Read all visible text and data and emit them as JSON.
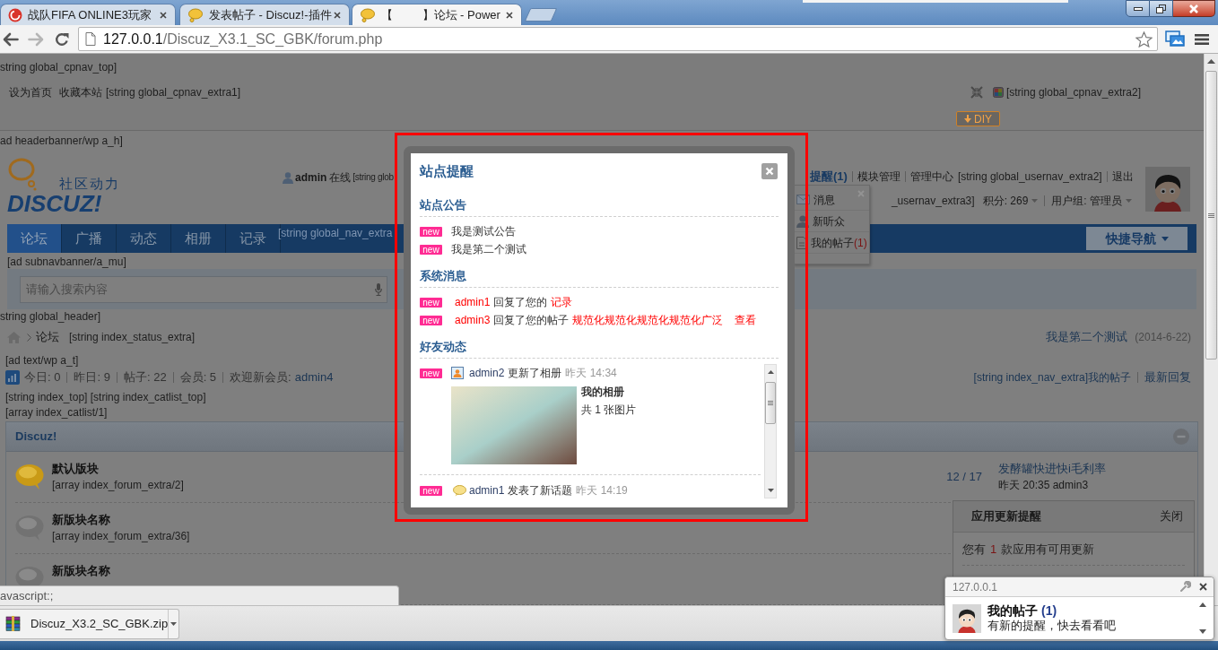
{
  "browser": {
    "tabs": [
      {
        "kind": "site",
        "title": "战队FIFA ONLINE3玩家",
        "selected": false
      },
      {
        "kind": "discuz",
        "title": "发表帖子 - Discuz!-插件",
        "selected": false
      },
      {
        "kind": "discuz",
        "title": "【         】论坛 - Power",
        "selected": true
      }
    ],
    "address": {
      "host": "127.0.0.1",
      "path": "/Discuz_X3.1_SC_GBK/forum.php"
    }
  },
  "page": {
    "cpnav_top": "string global_cpnav_top]",
    "cpnav_links": [
      "设为首页",
      "收藏本站"
    ],
    "cpnav_extra1": "[string global_cpnav_extra1]",
    "cpnav_extra2": "[string global_cpnav_extra2]",
    "diy": "DIY",
    "headerbanner": "ad headerbanner/wp a_h]",
    "logo": {
      "slogan": "社区动力",
      "wordmark": "DISCUZ!"
    },
    "user": {
      "name": "admin",
      "status": "在线",
      "extra": "[string glob"
    },
    "usernav": {
      "notice": "提醒(1)",
      "links": [
        "模块管理",
        "管理中心"
      ],
      "extra2": "[string global_usernav_extra2]",
      "logout": "退出",
      "extra3": "_usernav_extra3]",
      "credits": "积分: 269",
      "group": "用户组: 管理员"
    },
    "notice_menu": [
      {
        "kind": "mail",
        "label": "消息"
      },
      {
        "kind": "person",
        "label": "新听众"
      },
      {
        "kind": "post",
        "label": "我的帖子",
        "count": "(1)"
      }
    ],
    "nav": {
      "items": [
        {
          "label": "论坛",
          "selected": true
        },
        {
          "label": "广播",
          "selected": false
        },
        {
          "label": "动态",
          "selected": false
        },
        {
          "label": "相册",
          "selected": false
        },
        {
          "label": "记录",
          "selected": false
        }
      ],
      "extra": "[string global_nav_extra",
      "quick_nav": "快捷导航"
    },
    "subnavbanner": "[ad subnavbanner/a_mu]",
    "search": {
      "placeholder": "请输入搜索内容"
    },
    "global_header": "string global_header]",
    "breadcrumb": {
      "current": "论坛",
      "extra": "[string index_status_extra]",
      "latest": "我是第二个测试",
      "latest_date": "(2014-6-22)"
    },
    "ad_text": "[ad text/wp a_t]",
    "stats": {
      "items": [
        "今日: 0",
        "昨日: 9",
        "帖子: 22",
        "会员: 5"
      ],
      "welcome": "欢迎新会员:",
      "new_member": "admin4"
    },
    "index_nav": {
      "extra": "[string index_nav_extra]我的帖子",
      "latest_replies": "最新回复"
    },
    "index_top": "[string index_top] [string index_catlist_top]",
    "catlist": "[array index_catlist/1]",
    "forum": {
      "category": "Discuz!",
      "expanded": true,
      "forums": [
        {
          "name": "默认版块",
          "extra": "[array index_forum_extra/2]",
          "has_new": true,
          "counts": "12 / 17",
          "last_post": {
            "title": "发酵罐快进快i毛利率",
            "meta": "昨天 20:35 admin3"
          }
        },
        {
          "name": "新版块名称",
          "extra": "[array index_forum_extra/36]",
          "has_new": false
        },
        {
          "name": "新版块名称",
          "has_new": false
        }
      ]
    }
  },
  "dialog": {
    "title": "站点提醒",
    "sections": [
      {
        "heading": "站点公告",
        "items": [
          {
            "kind": "notice",
            "badge": "new",
            "text": "我是测试公告"
          },
          {
            "kind": "notice",
            "badge": "new",
            "text": "我是第二个测试"
          }
        ]
      },
      {
        "heading": "系统消息",
        "items": [
          {
            "kind": "reply",
            "badge": "new",
            "user": "admin1",
            "action": "回复了您的",
            "target": "记录"
          },
          {
            "kind": "reply",
            "badge": "new",
            "user": "admin3",
            "action": "回复了您的帖子",
            "target": "规范化规范化规范化规范化广泛",
            "link": "查看"
          }
        ]
      },
      {
        "heading": "好友动态",
        "feed": [
          {
            "kind": "album",
            "badge": "new",
            "user": "admin2",
            "action": "更新了相册",
            "time": "昨天 14:34",
            "album": {
              "title": "我的相册",
              "count": "共 1 张图片"
            }
          },
          {
            "kind": "topic",
            "badge": "new",
            "user": "admin1",
            "action": "发表了新话题",
            "time": "昨天 14:19"
          }
        ]
      }
    ]
  },
  "app_update": {
    "title": "应用更新提醒",
    "close": "关闭",
    "message_before": "您有",
    "count": "1",
    "message_after": "款应用有可用更新"
  },
  "status_url": "avascript:;",
  "download": {
    "filename": "Discuz_X3.2_SC_GBK.zip"
  },
  "notification": {
    "origin": "127.0.0.1",
    "title": "我的帖子",
    "count": "(1)",
    "message": "有新的提醒，快去看看吧"
  }
}
